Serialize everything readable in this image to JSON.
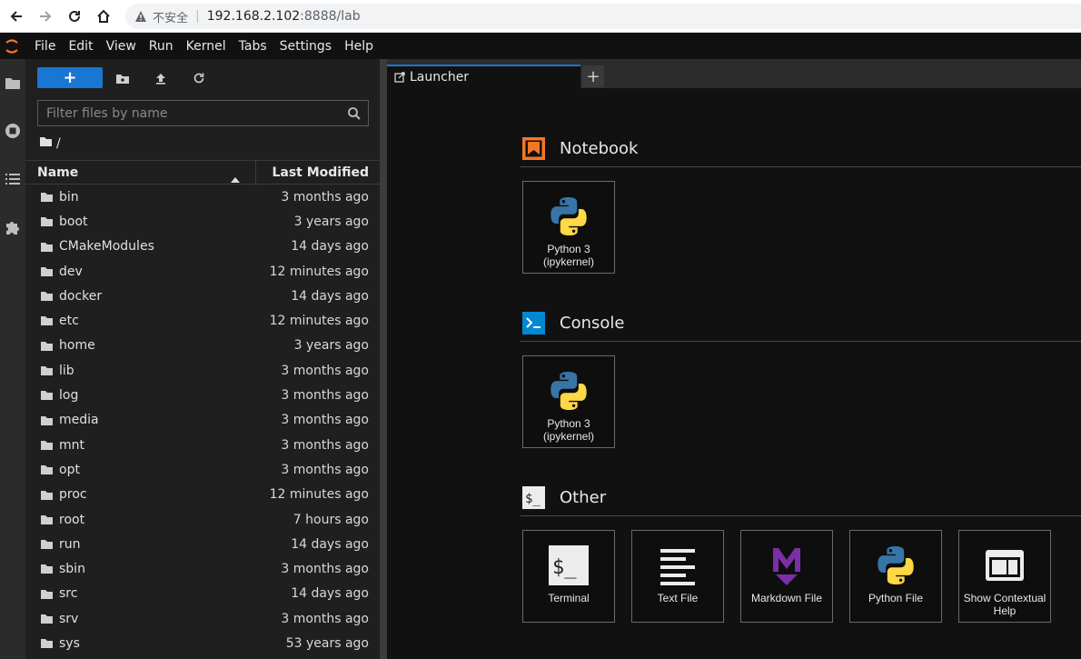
{
  "browser": {
    "insecure_label": "不安全",
    "url_host": "192.168.2.102",
    "url_path": ":8888/lab"
  },
  "menu": [
    "File",
    "Edit",
    "View",
    "Run",
    "Kernel",
    "Tabs",
    "Settings",
    "Help"
  ],
  "filebrowser": {
    "new_label": "+",
    "filter_placeholder": "Filter files by name",
    "breadcrumb": "/",
    "col_name": "Name",
    "col_modified": "Last Modified",
    "files": [
      {
        "name": "bin",
        "modified": "3 months ago"
      },
      {
        "name": "boot",
        "modified": "3 years ago"
      },
      {
        "name": "CMakeModules",
        "modified": "14 days ago"
      },
      {
        "name": "dev",
        "modified": "12 minutes ago"
      },
      {
        "name": "docker",
        "modified": "14 days ago"
      },
      {
        "name": "etc",
        "modified": "12 minutes ago"
      },
      {
        "name": "home",
        "modified": "3 years ago"
      },
      {
        "name": "lib",
        "modified": "3 months ago"
      },
      {
        "name": "log",
        "modified": "3 months ago"
      },
      {
        "name": "media",
        "modified": "3 months ago"
      },
      {
        "name": "mnt",
        "modified": "3 months ago"
      },
      {
        "name": "opt",
        "modified": "3 months ago"
      },
      {
        "name": "proc",
        "modified": "12 minutes ago"
      },
      {
        "name": "root",
        "modified": "7 hours ago"
      },
      {
        "name": "run",
        "modified": "14 days ago"
      },
      {
        "name": "sbin",
        "modified": "3 months ago"
      },
      {
        "name": "src",
        "modified": "14 days ago"
      },
      {
        "name": "srv",
        "modified": "3 months ago"
      },
      {
        "name": "sys",
        "modified": "53 years ago"
      }
    ]
  },
  "tabs": {
    "launcher_label": "Launcher",
    "add_label": "+"
  },
  "launcher": {
    "notebook": {
      "title": "Notebook",
      "cards": [
        {
          "label_line1": "Python 3",
          "label_line2": "(ipykernel)"
        }
      ]
    },
    "console": {
      "title": "Console",
      "cards": [
        {
          "label_line1": "Python 3",
          "label_line2": "(ipykernel)"
        }
      ]
    },
    "other": {
      "title": "Other",
      "cards": [
        {
          "label_line1": "Terminal",
          "label_line2": ""
        },
        {
          "label_line1": "Text File",
          "label_line2": ""
        },
        {
          "label_line1": "Markdown File",
          "label_line2": ""
        },
        {
          "label_line1": "Python File",
          "label_line2": ""
        },
        {
          "label_line1": "Show Contextual",
          "label_line2": "Help"
        }
      ]
    }
  },
  "colors": {
    "accent": "#1976d2",
    "notebook_icon": "#f37726",
    "console_icon": "#0288d1",
    "markdown_icon": "#7b2fa6"
  }
}
